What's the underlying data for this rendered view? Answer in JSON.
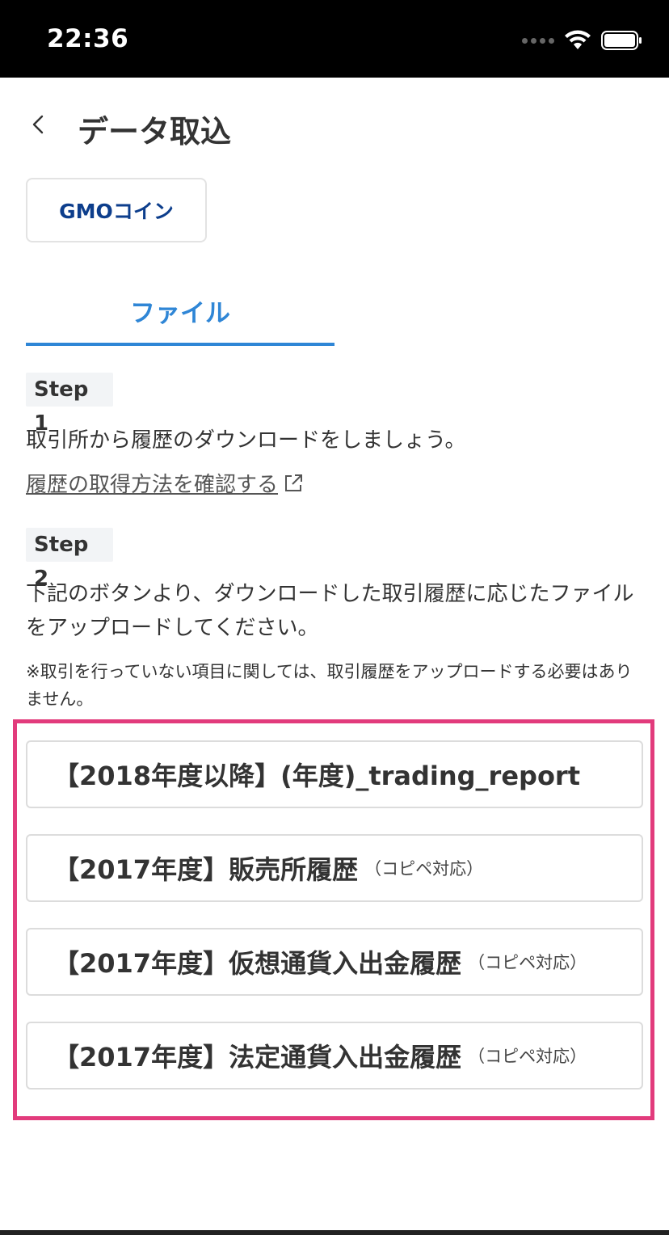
{
  "status_bar": {
    "time": "22:36"
  },
  "header": {
    "title": "データ取込"
  },
  "exchange": {
    "logo_gmo": "GMO",
    "logo_coin": "コイン"
  },
  "tabs": [
    {
      "label": "ファイル",
      "active": true
    }
  ],
  "step1": {
    "badge": "Step 1",
    "text": "取引所から履歴のダウンロードをしましょう。",
    "link": "履歴の取得方法を確認する"
  },
  "step2": {
    "badge": "Step 2",
    "text": "下記のボタンより、ダウンロードした取引履歴に応じたファイルをアップロードしてください。",
    "note": "※取引を行っていない項目に関しては、取引履歴をアップロードする必要はありません。"
  },
  "file_buttons": [
    {
      "label": "【2018年度以降】(年度)_trading_report",
      "sub": ""
    },
    {
      "label": "【2017年度】販売所履歴",
      "sub": "（コピペ対応）"
    },
    {
      "label": "【2017年度】仮想通貨入出金履歴",
      "sub": "（コピペ対応）"
    },
    {
      "label": "【2017年度】法定通貨入出金履歴",
      "sub": "（コピペ対応）"
    }
  ],
  "colors": {
    "accent": "#2f86d6",
    "highlight": "#e23b7c",
    "logo": "#0d3e8c"
  }
}
